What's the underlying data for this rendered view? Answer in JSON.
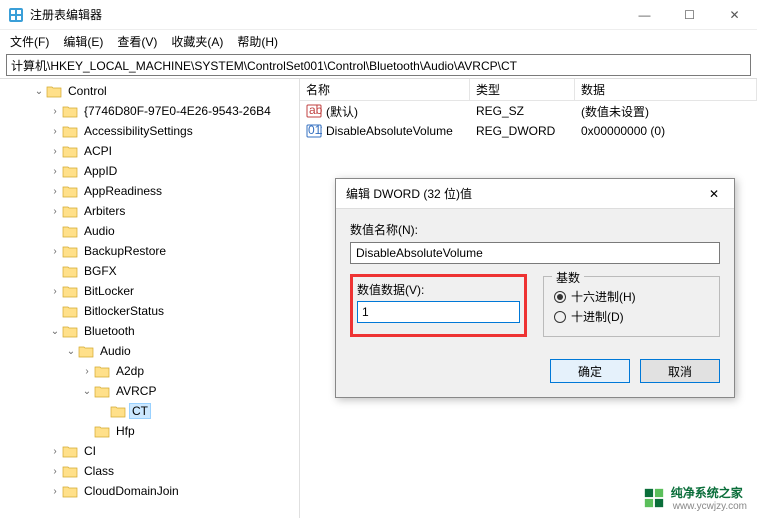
{
  "window": {
    "title": "注册表编辑器",
    "min": "—",
    "max": "☐",
    "close": "✕"
  },
  "menu": {
    "file": "文件(F)",
    "edit": "编辑(E)",
    "view": "查看(V)",
    "fav": "收藏夹(A)",
    "help": "帮助(H)"
  },
  "address": "计算机\\HKEY_LOCAL_MACHINE\\SYSTEM\\ControlSet001\\Control\\Bluetooth\\Audio\\AVRCP\\CT",
  "tree": [
    {
      "d": 2,
      "c": "open",
      "t": "Control"
    },
    {
      "d": 3,
      "c": "closed",
      "t": "{7746D80F-97E0-4E26-9543-26B4"
    },
    {
      "d": 3,
      "c": "closed",
      "t": "AccessibilitySettings"
    },
    {
      "d": 3,
      "c": "closed",
      "t": "ACPI"
    },
    {
      "d": 3,
      "c": "closed",
      "t": "AppID"
    },
    {
      "d": 3,
      "c": "closed",
      "t": "AppReadiness"
    },
    {
      "d": 3,
      "c": "closed",
      "t": "Arbiters"
    },
    {
      "d": 3,
      "c": "none",
      "t": "Audio"
    },
    {
      "d": 3,
      "c": "closed",
      "t": "BackupRestore"
    },
    {
      "d": 3,
      "c": "none",
      "t": "BGFX"
    },
    {
      "d": 3,
      "c": "closed",
      "t": "BitLocker"
    },
    {
      "d": 3,
      "c": "none",
      "t": "BitlockerStatus"
    },
    {
      "d": 3,
      "c": "open",
      "t": "Bluetooth"
    },
    {
      "d": 4,
      "c": "open",
      "t": "Audio"
    },
    {
      "d": 5,
      "c": "closed",
      "t": "A2dp"
    },
    {
      "d": 5,
      "c": "open",
      "t": "AVRCP"
    },
    {
      "d": 6,
      "c": "none",
      "t": "CT",
      "sel": true
    },
    {
      "d": 5,
      "c": "none",
      "t": "Hfp"
    },
    {
      "d": 3,
      "c": "closed",
      "t": "CI"
    },
    {
      "d": 3,
      "c": "closed",
      "t": "Class"
    },
    {
      "d": 3,
      "c": "closed",
      "t": "CloudDomainJoin"
    }
  ],
  "vals": {
    "col_name": "名称",
    "col_type": "类型",
    "col_data": "数据",
    "rows": [
      {
        "icon": "str",
        "name": "(默认)",
        "type": "REG_SZ",
        "data": "(数值未设置)"
      },
      {
        "icon": "bin",
        "name": "DisableAbsoluteVolume",
        "type": "REG_DWORD",
        "data": "0x00000000 (0)"
      }
    ]
  },
  "dialog": {
    "title": "编辑 DWORD (32 位)值",
    "name_label": "数值名称(N):",
    "name_value": "DisableAbsoluteVolume",
    "data_label": "数值数据(V):",
    "data_value": "1",
    "base_legend": "基数",
    "hex": "十六进制(H)",
    "dec": "十进制(D)",
    "ok": "确定",
    "cancel": "取消",
    "close": "✕"
  },
  "watermark": {
    "text": "纯净系统之家",
    "url": "www.ycwjzy.com"
  }
}
